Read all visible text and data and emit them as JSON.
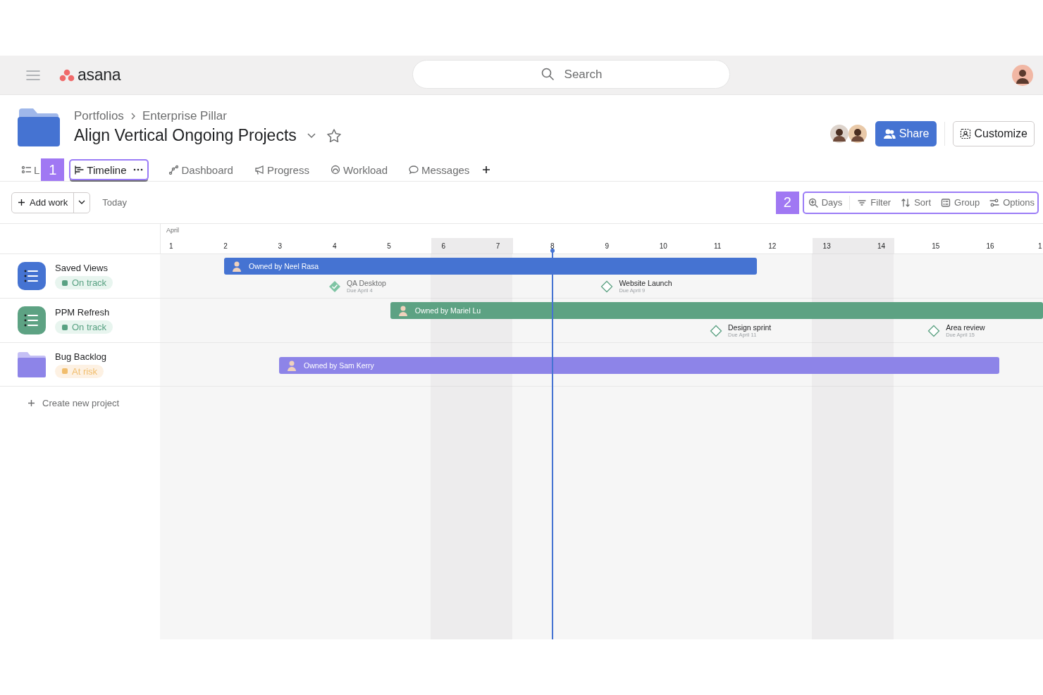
{
  "top_bar": {
    "logo": "asana",
    "search": {
      "placeholder": "Search"
    }
  },
  "header": {
    "breadcrumb": [
      "Portfolios",
      "Enterprise Pillar"
    ],
    "title": "Align Vertical Ongoing Projects",
    "share_button": "Share",
    "customize_button": "Customize"
  },
  "view_tabs": {
    "marker": "1",
    "items": [
      {
        "label": "L",
        "selected": false
      },
      {
        "label": "Timeline",
        "selected": true
      },
      {
        "label": "Dashboard",
        "selected": false
      },
      {
        "label": "Progress",
        "selected": false
      },
      {
        "label": "Workload",
        "selected": false
      },
      {
        "label": "Messages",
        "selected": false
      }
    ]
  },
  "toolbar": {
    "add_work": "Add work",
    "today": "Today",
    "marker": "2",
    "controls": [
      "Days",
      "Filter",
      "Sort",
      "Group",
      "Options"
    ]
  },
  "timeline": {
    "month": "April",
    "days": [
      {
        "label": "1",
        "weekend": false
      },
      {
        "label": "2",
        "weekend": false
      },
      {
        "label": "3",
        "weekend": false
      },
      {
        "label": "4",
        "weekend": false
      },
      {
        "label": "5",
        "weekend": false
      },
      {
        "label": "6",
        "weekend": true
      },
      {
        "label": "7",
        "weekend": true
      },
      {
        "label": "8",
        "weekend": false
      },
      {
        "label": "9",
        "weekend": false
      },
      {
        "label": "10",
        "weekend": false
      },
      {
        "label": "11",
        "weekend": false
      },
      {
        "label": "12",
        "weekend": false
      },
      {
        "label": "13",
        "weekend": true
      },
      {
        "label": "14",
        "weekend": true
      },
      {
        "label": "15",
        "weekend": false
      },
      {
        "label": "16",
        "weekend": false
      },
      {
        "label": "1",
        "weekend": false
      }
    ],
    "projects": [
      {
        "name": "Saved Views",
        "kind": "list",
        "color": "#4573d2",
        "status": {
          "label": "On track",
          "kind": "on_track"
        },
        "bar": "Owned by Neel Rasa",
        "milestones": [
          {
            "name": "QA Desktop",
            "due": "Due April 4",
            "completed": true
          },
          {
            "name": "Website Launch",
            "due": "Due April 9",
            "completed": false
          }
        ]
      },
      {
        "name": "PPM Refresh",
        "kind": "list",
        "color": "#5da283",
        "status": {
          "label": "On track",
          "kind": "on_track"
        },
        "bar": "Owned by Mariel Lu",
        "milestones": [
          {
            "name": "Design sprint",
            "due": "Due April 11",
            "completed": false
          },
          {
            "name": "Area review",
            "due": "Due April 15",
            "completed": false
          }
        ]
      },
      {
        "name": "Bug Backlog",
        "kind": "folder",
        "color": "#8d84e8",
        "status": {
          "label": "At risk",
          "kind": "at_risk"
        },
        "bar": "Owned by Sam Kerry"
      }
    ],
    "create_project": "Create new project"
  }
}
